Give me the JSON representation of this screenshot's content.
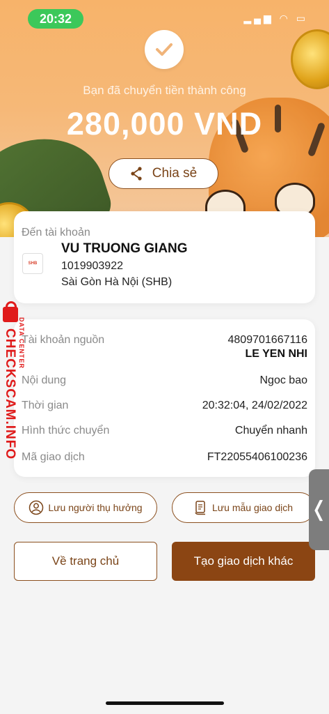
{
  "status_bar": {
    "time": "20:32"
  },
  "hero": {
    "success_text": "Bạn đã chuyển tiền thành công",
    "amount": "280,000 VND",
    "share_label": "Chia sẻ"
  },
  "recipient": {
    "to_label": "Đến tài khoản",
    "bank_logo_text": "SHB",
    "name": "VU TRUONG GIANG",
    "account_number": "1019903922",
    "bank": "Sài Gòn Hà Nội (SHB)"
  },
  "details": [
    {
      "label": "Tài khoản nguồn",
      "value": "4809701667116",
      "value2": "LE YEN NHI"
    },
    {
      "label": "Nội dung",
      "value": "Ngoc bao"
    },
    {
      "label": "Thời gian",
      "value": "20:32:04, 24/02/2022"
    },
    {
      "label": "Hình thức chuyển",
      "value": "Chuyển nhanh"
    },
    {
      "label": "Mã giao dịch",
      "value": "FT22055406100236"
    }
  ],
  "actions": {
    "save_beneficiary": "Lưu người thụ hưởng",
    "save_template": "Lưu mẫu giao dịch",
    "home": "Về trang chủ",
    "new_transaction": "Tạo giao dịch khác"
  },
  "side_tab_glyph": "❬",
  "watermark": {
    "main": "CHECKSCAM.INFO",
    "sub": "DATA CENTER"
  },
  "colors": {
    "brand_brown": "#8b4513",
    "time_green": "#3cc85a",
    "watermark_red": "#e01b1b"
  }
}
